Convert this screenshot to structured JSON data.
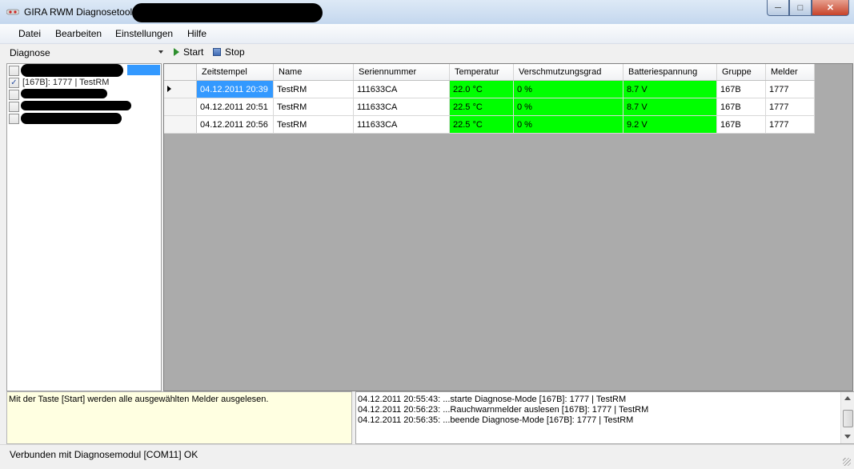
{
  "window": {
    "title": "GIRA RWM Diagnosetool",
    "controls": {
      "minimize": "─",
      "maximize": "□",
      "close": "✕"
    }
  },
  "menu": [
    "Datei",
    "Bearbeiten",
    "Einstellungen",
    "Hilfe"
  ],
  "toolbar": {
    "mode_select": "Diagnose",
    "start_label": "Start",
    "stop_label": "Stop"
  },
  "tree": {
    "items": [
      {
        "label": "",
        "checked": false,
        "redacted": true
      },
      {
        "label": "[167B]: 1777 | TestRM",
        "checked": true,
        "redacted": false
      },
      {
        "label": "",
        "checked": false,
        "redacted": true
      },
      {
        "label": "",
        "checked": false,
        "redacted": true
      },
      {
        "label": "",
        "checked": false,
        "redacted": true
      }
    ]
  },
  "grid": {
    "columns": [
      "Zeitstempel",
      "Name",
      "Seriennummer",
      "Temperatur",
      "Verschmutzungsgrad",
      "Batteriespannung",
      "Gruppe",
      "Melder"
    ],
    "rows": [
      [
        "04.12.2011 20:39",
        "TestRM",
        "111633CA",
        "22.0 °C",
        "0 %",
        "8.7 V",
        "167B",
        "1777"
      ],
      [
        "04.12.2011 20:51",
        "TestRM",
        "111633CA",
        "22.5 °C",
        "0 %",
        "8.7 V",
        "167B",
        "1777"
      ],
      [
        "04.12.2011 20:56",
        "TestRM",
        "111633CA",
        "22.5 °C",
        "0 %",
        "9.2 V",
        "167B",
        "1777"
      ]
    ],
    "ok_color": "#00ff00",
    "selection_color": "#3399ff"
  },
  "hint": "Mit der Taste [Start] werden alle ausgewählten Melder ausgelesen.",
  "log": [
    "04.12.2011 20:55:43: ...starte Diagnose-Mode [167B]: 1777 | TestRM",
    "04.12.2011 20:56:23: ...Rauchwarnmelder auslesen [167B]: 1777 | TestRM",
    "04.12.2011 20:56:35: ...beende Diagnose-Mode [167B]: 1777 | TestRM"
  ],
  "status": "Verbunden mit Diagnosemodul [COM11]  OK"
}
